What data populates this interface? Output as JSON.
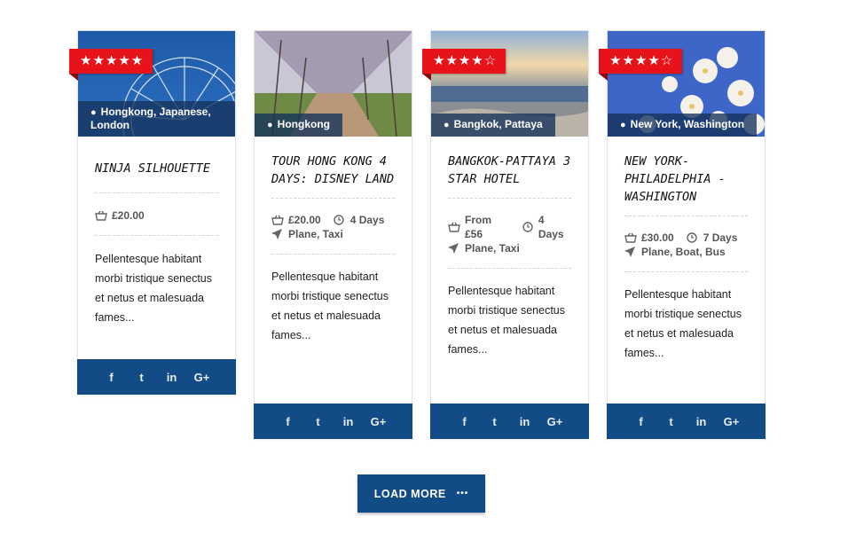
{
  "cards": [
    {
      "rating": "★★★★★",
      "location": "Hongkong, Japanese, London",
      "title": "NINJA SILHOUETTE",
      "price": "£20.00",
      "description": "Pellentesque habitant morbi tristique senectus et netus et malesuada fames...",
      "image": "ferris-wheel-photo"
    },
    {
      "rating": "",
      "location": "Hongkong",
      "title": "TOUR HONG KONG 4 DAYS: DISNEY LAND",
      "price": "£20.00",
      "duration": "4 Days",
      "transport": "Plane, Taxi",
      "description": "Pellentesque habitant morbi tristique senectus et netus et malesuada fames...",
      "image": "tree-avenue-photo"
    },
    {
      "rating": "★★★★☆",
      "location": "Bangkok, Pattaya",
      "title": "BANGKOK-PATTAYA 3 STAR HOTEL",
      "price": "From £56",
      "duration": "4 Days",
      "transport": "Plane, Taxi",
      "description": "Pellentesque habitant morbi tristique senectus et netus et malesuada fames...",
      "image": "seaside-photo"
    },
    {
      "rating": "★★★★☆",
      "location": "New York, Washington",
      "title": "NEW YORK-PHILADELPHIA - WASHINGTON",
      "price": "£30.00",
      "duration": "7 Days",
      "transport": "Plane, Boat, Bus",
      "description": "Pellentesque habitant morbi tristique senectus et netus et malesuada fames...",
      "image": "blossom-photo"
    }
  ],
  "social": [
    "f",
    "t",
    "in",
    "G+"
  ],
  "social_icons": [
    "facebook-icon",
    "twitter-icon",
    "linkedin-icon",
    "google-plus-icon"
  ],
  "load_more": {
    "label": "LOAD MORE",
    "dots": "•••"
  },
  "colors": {
    "accent": "#124b86",
    "rating": "#e8121a"
  }
}
